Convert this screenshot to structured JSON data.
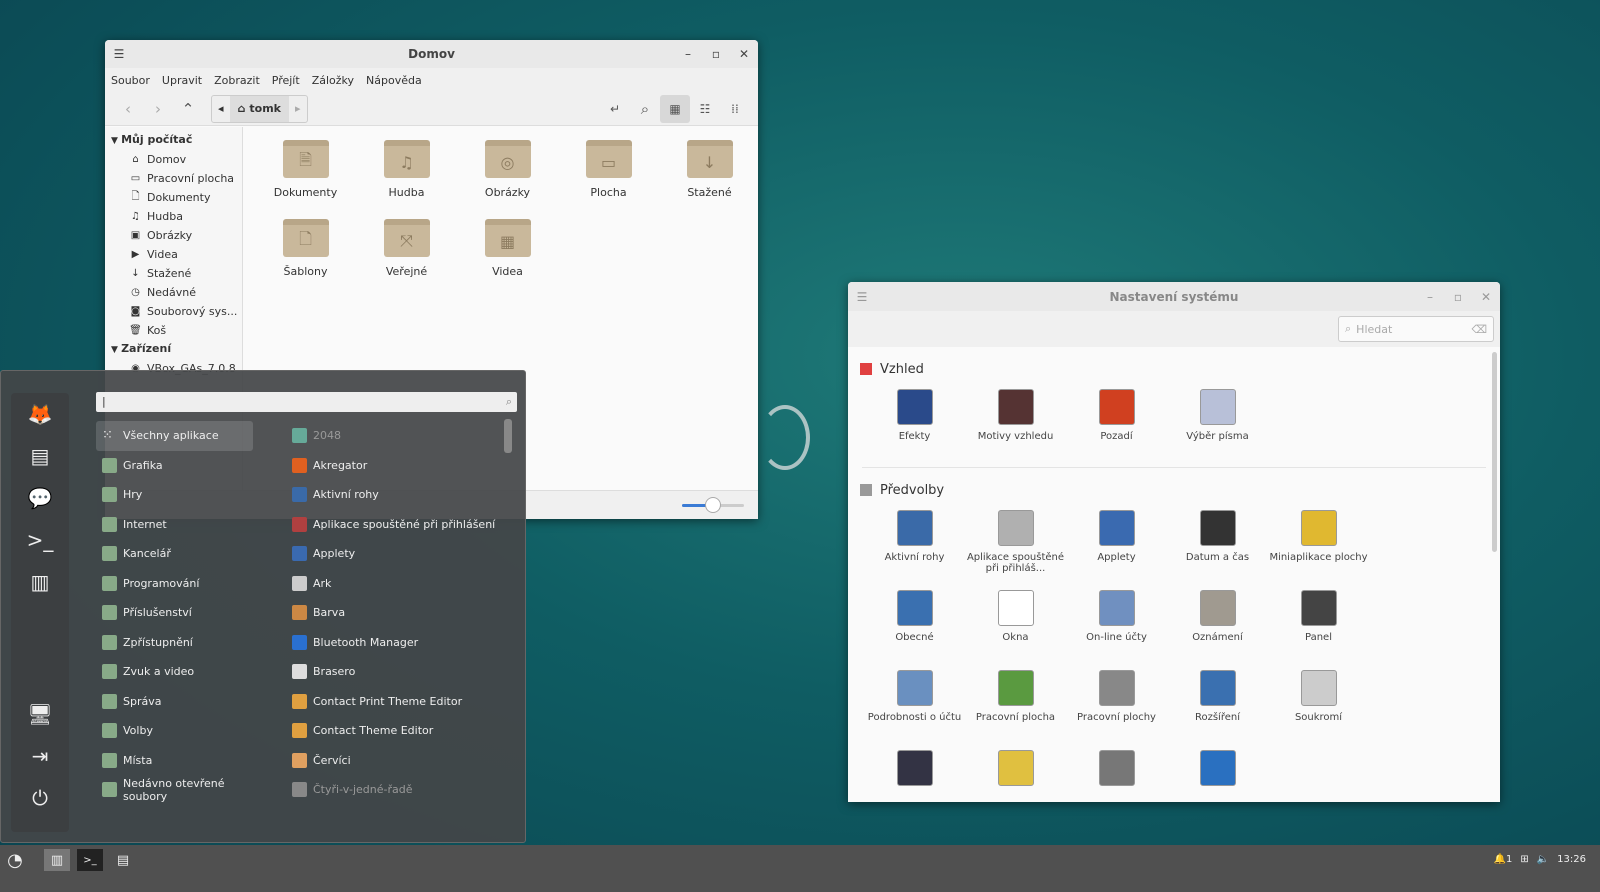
{
  "file_manager": {
    "title": "Domov",
    "menu": [
      "Soubor",
      "Upravit",
      "Zobrazit",
      "Přejít",
      "Záložky",
      "Nápověda"
    ],
    "breadcrumb": "tomk",
    "sidebar": {
      "sections": [
        {
          "label": "Můj počítač",
          "items": [
            {
              "label": "Domov",
              "icon": "home-icon"
            },
            {
              "label": "Pracovní plocha",
              "icon": "folder-icon"
            },
            {
              "label": "Dokumenty",
              "icon": "document-icon"
            },
            {
              "label": "Hudba",
              "icon": "music-icon"
            },
            {
              "label": "Obrázky",
              "icon": "image-icon"
            },
            {
              "label": "Videa",
              "icon": "video-icon"
            },
            {
              "label": "Stažené",
              "icon": "download-icon"
            },
            {
              "label": "Nedávné",
              "icon": "clock-icon"
            },
            {
              "label": "Souborový sys...",
              "icon": "drive-icon"
            },
            {
              "label": "Koš",
              "icon": "trash-icon"
            }
          ]
        },
        {
          "label": "Zařízení",
          "items": [
            {
              "label": "VBox_GAs_7.0.8",
              "icon": "disc-icon"
            }
          ]
        }
      ]
    },
    "folders": [
      {
        "label": "Dokumenty",
        "glyph": "🗎"
      },
      {
        "label": "Hudba",
        "glyph": "♫"
      },
      {
        "label": "Obrázky",
        "glyph": "◎"
      },
      {
        "label": "Plocha",
        "glyph": "▭"
      },
      {
        "label": "Stažené",
        "glyph": "↓"
      },
      {
        "label": "Šablony",
        "glyph": "🗋"
      },
      {
        "label": "Veřejné",
        "glyph": "⤧"
      },
      {
        "label": "Videa",
        "glyph": "▦"
      }
    ],
    "zoom_level": 0.5
  },
  "settings": {
    "title": "Nastavení systému",
    "search_placeholder": "Hledat",
    "sections": [
      {
        "label": "Vzhled",
        "color": "#e04040",
        "items": [
          {
            "label": "Efekty",
            "color": "#2a4a8a"
          },
          {
            "label": "Motivy vzhledu",
            "color": "#553333"
          },
          {
            "label": "Pozadí",
            "color": "#d04020"
          },
          {
            "label": "Výběr písma",
            "color": "#b8c0d8"
          }
        ]
      },
      {
        "label": "Předvolby",
        "color": "#999999",
        "items": [
          {
            "label": "Aktivní rohy",
            "color": "#3a6aa8"
          },
          {
            "label": "Aplikace spouštěné při přihláš...",
            "color": "#b0b0b0"
          },
          {
            "label": "Applety",
            "color": "#3a6ab0"
          },
          {
            "label": "Datum a čas",
            "color": "#333333"
          },
          {
            "label": "Miniaplikace plochy",
            "color": "#e0b830"
          },
          {
            "label": "Obecné",
            "color": "#3a70b0"
          },
          {
            "label": "Okna",
            "color": "#ffffff"
          },
          {
            "label": "On-line účty",
            "color": "#7090c0"
          },
          {
            "label": "Oznámení",
            "color": "#a09a90"
          },
          {
            "label": "Panel",
            "color": "#444444"
          },
          {
            "label": "Podrobnosti o účtu",
            "color": "#6a90c0"
          },
          {
            "label": "Pracovní plocha",
            "color": "#5a9a40"
          },
          {
            "label": "Pracovní plochy",
            "color": "#888888"
          },
          {
            "label": "Rozšíření",
            "color": "#3a70b0"
          },
          {
            "label": "Soukromí",
            "color": "#cccccc"
          },
          {
            "label": "",
            "color": "#333344"
          },
          {
            "label": "",
            "color": "#e0c040"
          },
          {
            "label": "",
            "color": "#777777"
          },
          {
            "label": "",
            "color": "#2a70c0"
          }
        ]
      }
    ]
  },
  "app_menu": {
    "search_value": "",
    "favorites": [
      {
        "icon": "firefox-icon",
        "glyph": "🦊"
      },
      {
        "icon": "software-manager-icon",
        "glyph": "▤"
      },
      {
        "icon": "chat-icon",
        "glyph": "💬"
      },
      {
        "icon": "terminal-icon",
        "glyph": ">_"
      },
      {
        "icon": "files-icon",
        "glyph": "▥"
      },
      {
        "icon": "lock-screen-icon",
        "glyph": "🖥"
      },
      {
        "icon": "logout-icon",
        "glyph": "⇥"
      },
      {
        "icon": "shutdown-icon",
        "glyph": "⏻"
      }
    ],
    "categories": [
      "Všechny aplikace",
      "Grafika",
      "Hry",
      "Internet",
      "Kancelář",
      "Programování",
      "Příslušenství",
      "Zpřístupnění",
      "Zvuk a video",
      "Správa",
      "Volby",
      "Místa",
      "Nedávno otevřené soubory"
    ],
    "apps": [
      {
        "label": "2048",
        "dim": true,
        "color": "#6a9"
      },
      {
        "label": "Akregator",
        "color": "#e06020"
      },
      {
        "label": "Aktivní rohy",
        "color": "#3a6aa8"
      },
      {
        "label": "Aplikace spouštěné při přihlášení",
        "color": "#b04040"
      },
      {
        "label": "Applety",
        "color": "#3a6ab0"
      },
      {
        "label": "Ark",
        "color": "#ccc"
      },
      {
        "label": "Barva",
        "color": "#c84"
      },
      {
        "label": "Bluetooth Manager",
        "color": "#2a70d0"
      },
      {
        "label": "Brasero",
        "color": "#ddd"
      },
      {
        "label": "Contact Print Theme Editor",
        "color": "#e0a040"
      },
      {
        "label": "Contact Theme Editor",
        "color": "#e0a040"
      },
      {
        "label": "Červíci",
        "color": "#e0a060"
      },
      {
        "label": "Čtyři-v-jedné-řadě",
        "dim": true,
        "color": "#888"
      }
    ]
  },
  "taskbar": {
    "clock": "13:26",
    "notifications": "1"
  }
}
